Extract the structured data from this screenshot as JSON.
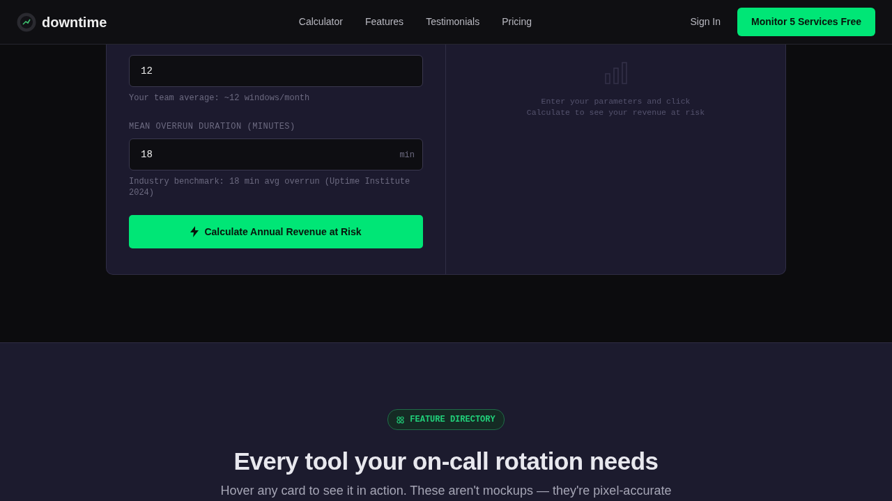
{
  "navbar": {
    "brand": "downtime",
    "links": [
      "Calculator",
      "Features",
      "Testimonials",
      "Pricing"
    ],
    "sign_in": "Sign In",
    "cta": "Monitor 5 Services Free"
  },
  "calculator": {
    "fields": [
      {
        "value": "12",
        "hint": "Your team average: ~12 windows/month"
      },
      {
        "label": "MEAN OVERRUN DURATION (MINUTES)",
        "value": "18",
        "unit": "min",
        "hint": "Industry benchmark: 18 min avg overrun (Uptime Institute 2024)"
      }
    ],
    "button": "Calculate Annual Revenue at Risk",
    "empty_state": {
      "line_1": "Enter your parameters and click",
      "line_2": "Calculate to see your revenue at risk"
    }
  },
  "features": {
    "badge": "FEATURE DIRECTORY",
    "heading": "Every tool your on-call rotation needs",
    "subtitle": "Hover any card to see it in action. These aren't mockups — they're pixel-accurate"
  }
}
